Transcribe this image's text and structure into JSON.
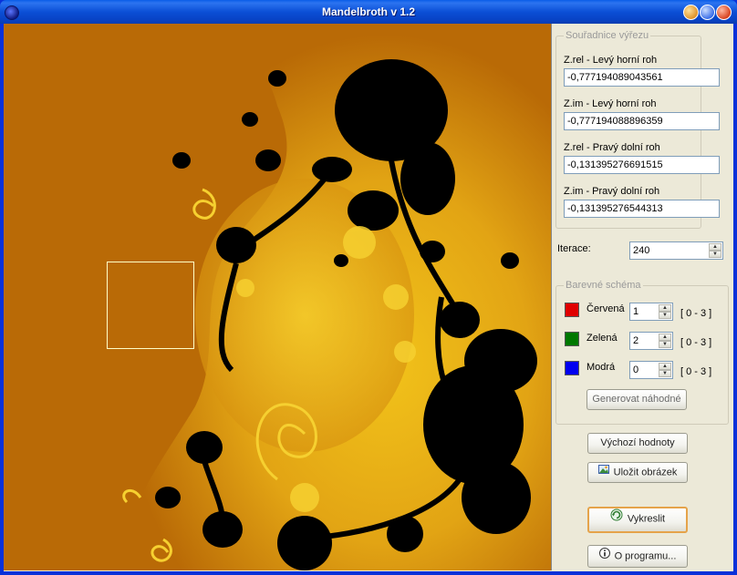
{
  "window": {
    "title": "Mandelbroth v 1.2"
  },
  "coords_group": {
    "legend": "Souřadnice výřezu",
    "fields": [
      {
        "label": "Z.rel - Levý horní roh",
        "value": "-0,777194089043561"
      },
      {
        "label": "Z.im - Levý horní roh",
        "value": "-0,777194088896359"
      },
      {
        "label": "Z.rel - Pravý dolní roh",
        "value": "-0,131395276691515"
      },
      {
        "label": "Z.im - Pravý dolní roh",
        "value": "-0,131395276544313"
      }
    ]
  },
  "iterations": {
    "label": "Iterace:",
    "value": "240"
  },
  "color_group": {
    "legend": "Barevné schéma",
    "channels": [
      {
        "label": "Červená",
        "color": "#E00000",
        "value": "1",
        "range": "[ 0 - 3 ]"
      },
      {
        "label": "Zelená",
        "color": "#007800",
        "value": "2",
        "range": "[ 0 - 3 ]"
      },
      {
        "label": "Modrá",
        "color": "#0000F0",
        "value": "0",
        "range": "[ 0 - 3 ]"
      }
    ],
    "random_button": "Generovat náhodné"
  },
  "buttons": {
    "defaults": "Výchozí hodnoty",
    "save": "Uložit obrázek",
    "draw": "Vykreslit",
    "about": "O programu..."
  },
  "colors": {
    "fractal_bg": "#B96A06",
    "fractal_inner": "#000000",
    "fractal_edge": "#F2C31A",
    "selection": "#FFFFC8"
  }
}
